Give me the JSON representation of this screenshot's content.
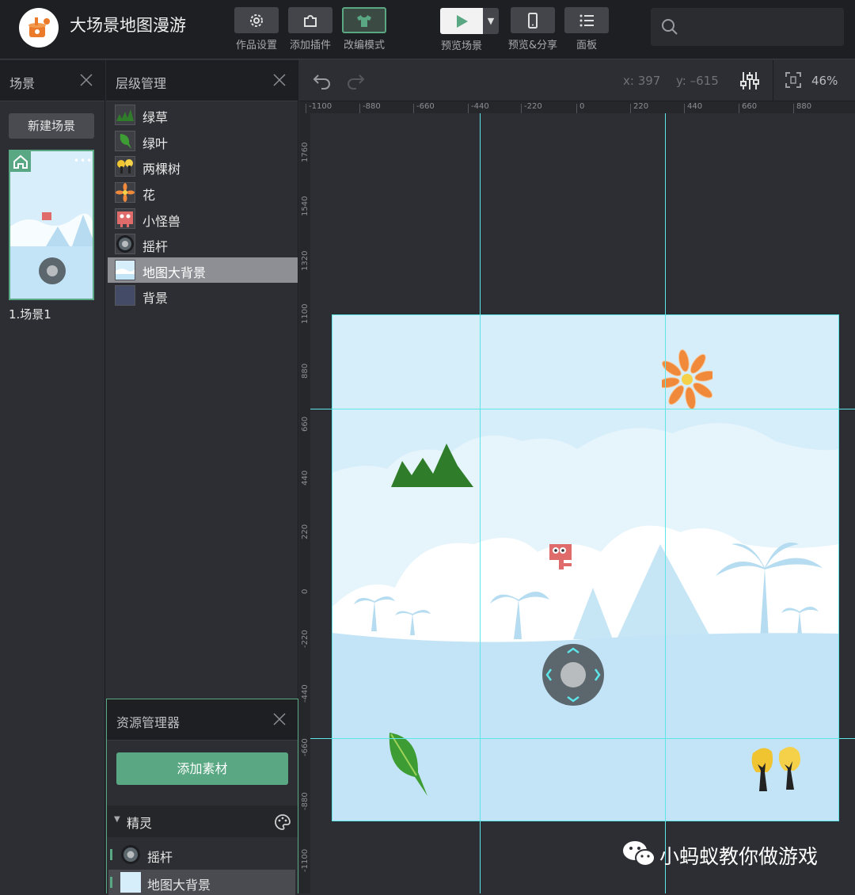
{
  "app": {
    "title": "大场景地图漫游"
  },
  "toolbar": {
    "settings_label": "作品设置",
    "plugin_label": "添加插件",
    "remix_label": "改编模式",
    "preview_label": "预览场景",
    "share_label": "预览&分享",
    "panel_label": "面板"
  },
  "scene_panel": {
    "title": "场景",
    "new_button": "新建场景",
    "scene_name": "1.场景1"
  },
  "layer_panel": {
    "title": "层级管理",
    "items": [
      {
        "label": "绿草",
        "icon": "grass-icon"
      },
      {
        "label": "绿叶",
        "icon": "leaf-icon"
      },
      {
        "label": "两棵树",
        "icon": "trees-icon"
      },
      {
        "label": "花",
        "icon": "flower-icon"
      },
      {
        "label": "小怪兽",
        "icon": "monster-icon"
      },
      {
        "label": "摇杆",
        "icon": "joystick-icon"
      },
      {
        "label": "地图大背景",
        "icon": "map-background-icon",
        "selected": true
      },
      {
        "label": "背景",
        "icon": "background-icon"
      }
    ]
  },
  "asset_panel": {
    "title": "资源管理器",
    "add_button": "添加素材",
    "section_title": "精灵",
    "items": [
      {
        "label": "摇杆"
      },
      {
        "label": "地图大背景"
      }
    ]
  },
  "canvas": {
    "x_readout": "x: 397",
    "y_readout": "y: –615",
    "zoom": "46%",
    "ruler_x": [
      "-1100",
      "-880",
      "-660",
      "-440",
      "-220",
      "0",
      "220",
      "440",
      "660",
      "880"
    ],
    "ruler_y": [
      "1760",
      "1540",
      "1320",
      "1100",
      "880",
      "660",
      "440",
      "220",
      "0",
      "-220",
      "-440",
      "-660",
      "-880",
      "-1100"
    ]
  },
  "watermark": {
    "text": "小蚂蚁教你做游戏"
  },
  "colors": {
    "accent": "#5aa883",
    "guide": "#5ee5e8",
    "sky": "#d6eefa",
    "grass": "#2f7d2a"
  }
}
